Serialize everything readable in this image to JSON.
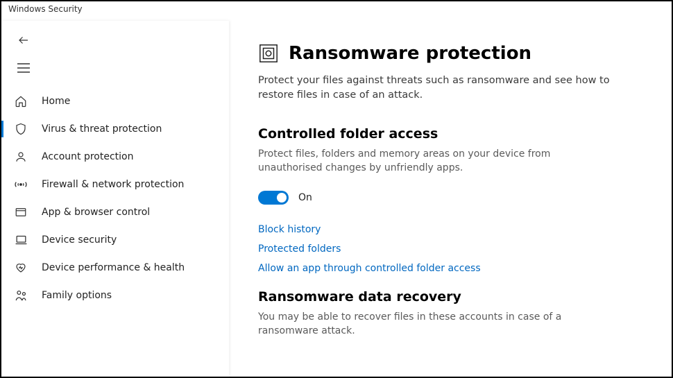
{
  "window": {
    "title": "Windows Security"
  },
  "sidebar": {
    "items": [
      {
        "label": "Home"
      },
      {
        "label": "Virus & threat protection"
      },
      {
        "label": "Account protection"
      },
      {
        "label": "Firewall & network protection"
      },
      {
        "label": "App & browser control"
      },
      {
        "label": "Device security"
      },
      {
        "label": "Device performance & health"
      },
      {
        "label": "Family options"
      }
    ]
  },
  "page": {
    "title": "Ransomware protection",
    "description": "Protect your files against threats such as ransomware and see how to restore files in case of an attack."
  },
  "cfa": {
    "title": "Controlled folder access",
    "description": "Protect files, folders and memory areas on your device from unauthorised changes by unfriendly apps.",
    "toggle_state": "On",
    "links": {
      "block_history": "Block history",
      "protected_folders": "Protected folders",
      "allow_app": "Allow an app through controlled folder access"
    }
  },
  "recovery": {
    "title": "Ransomware data recovery",
    "description": "You may be able to recover files in these accounts in case of a ransomware attack."
  },
  "colors": {
    "accent": "#0078d4",
    "link": "#0067c0"
  }
}
